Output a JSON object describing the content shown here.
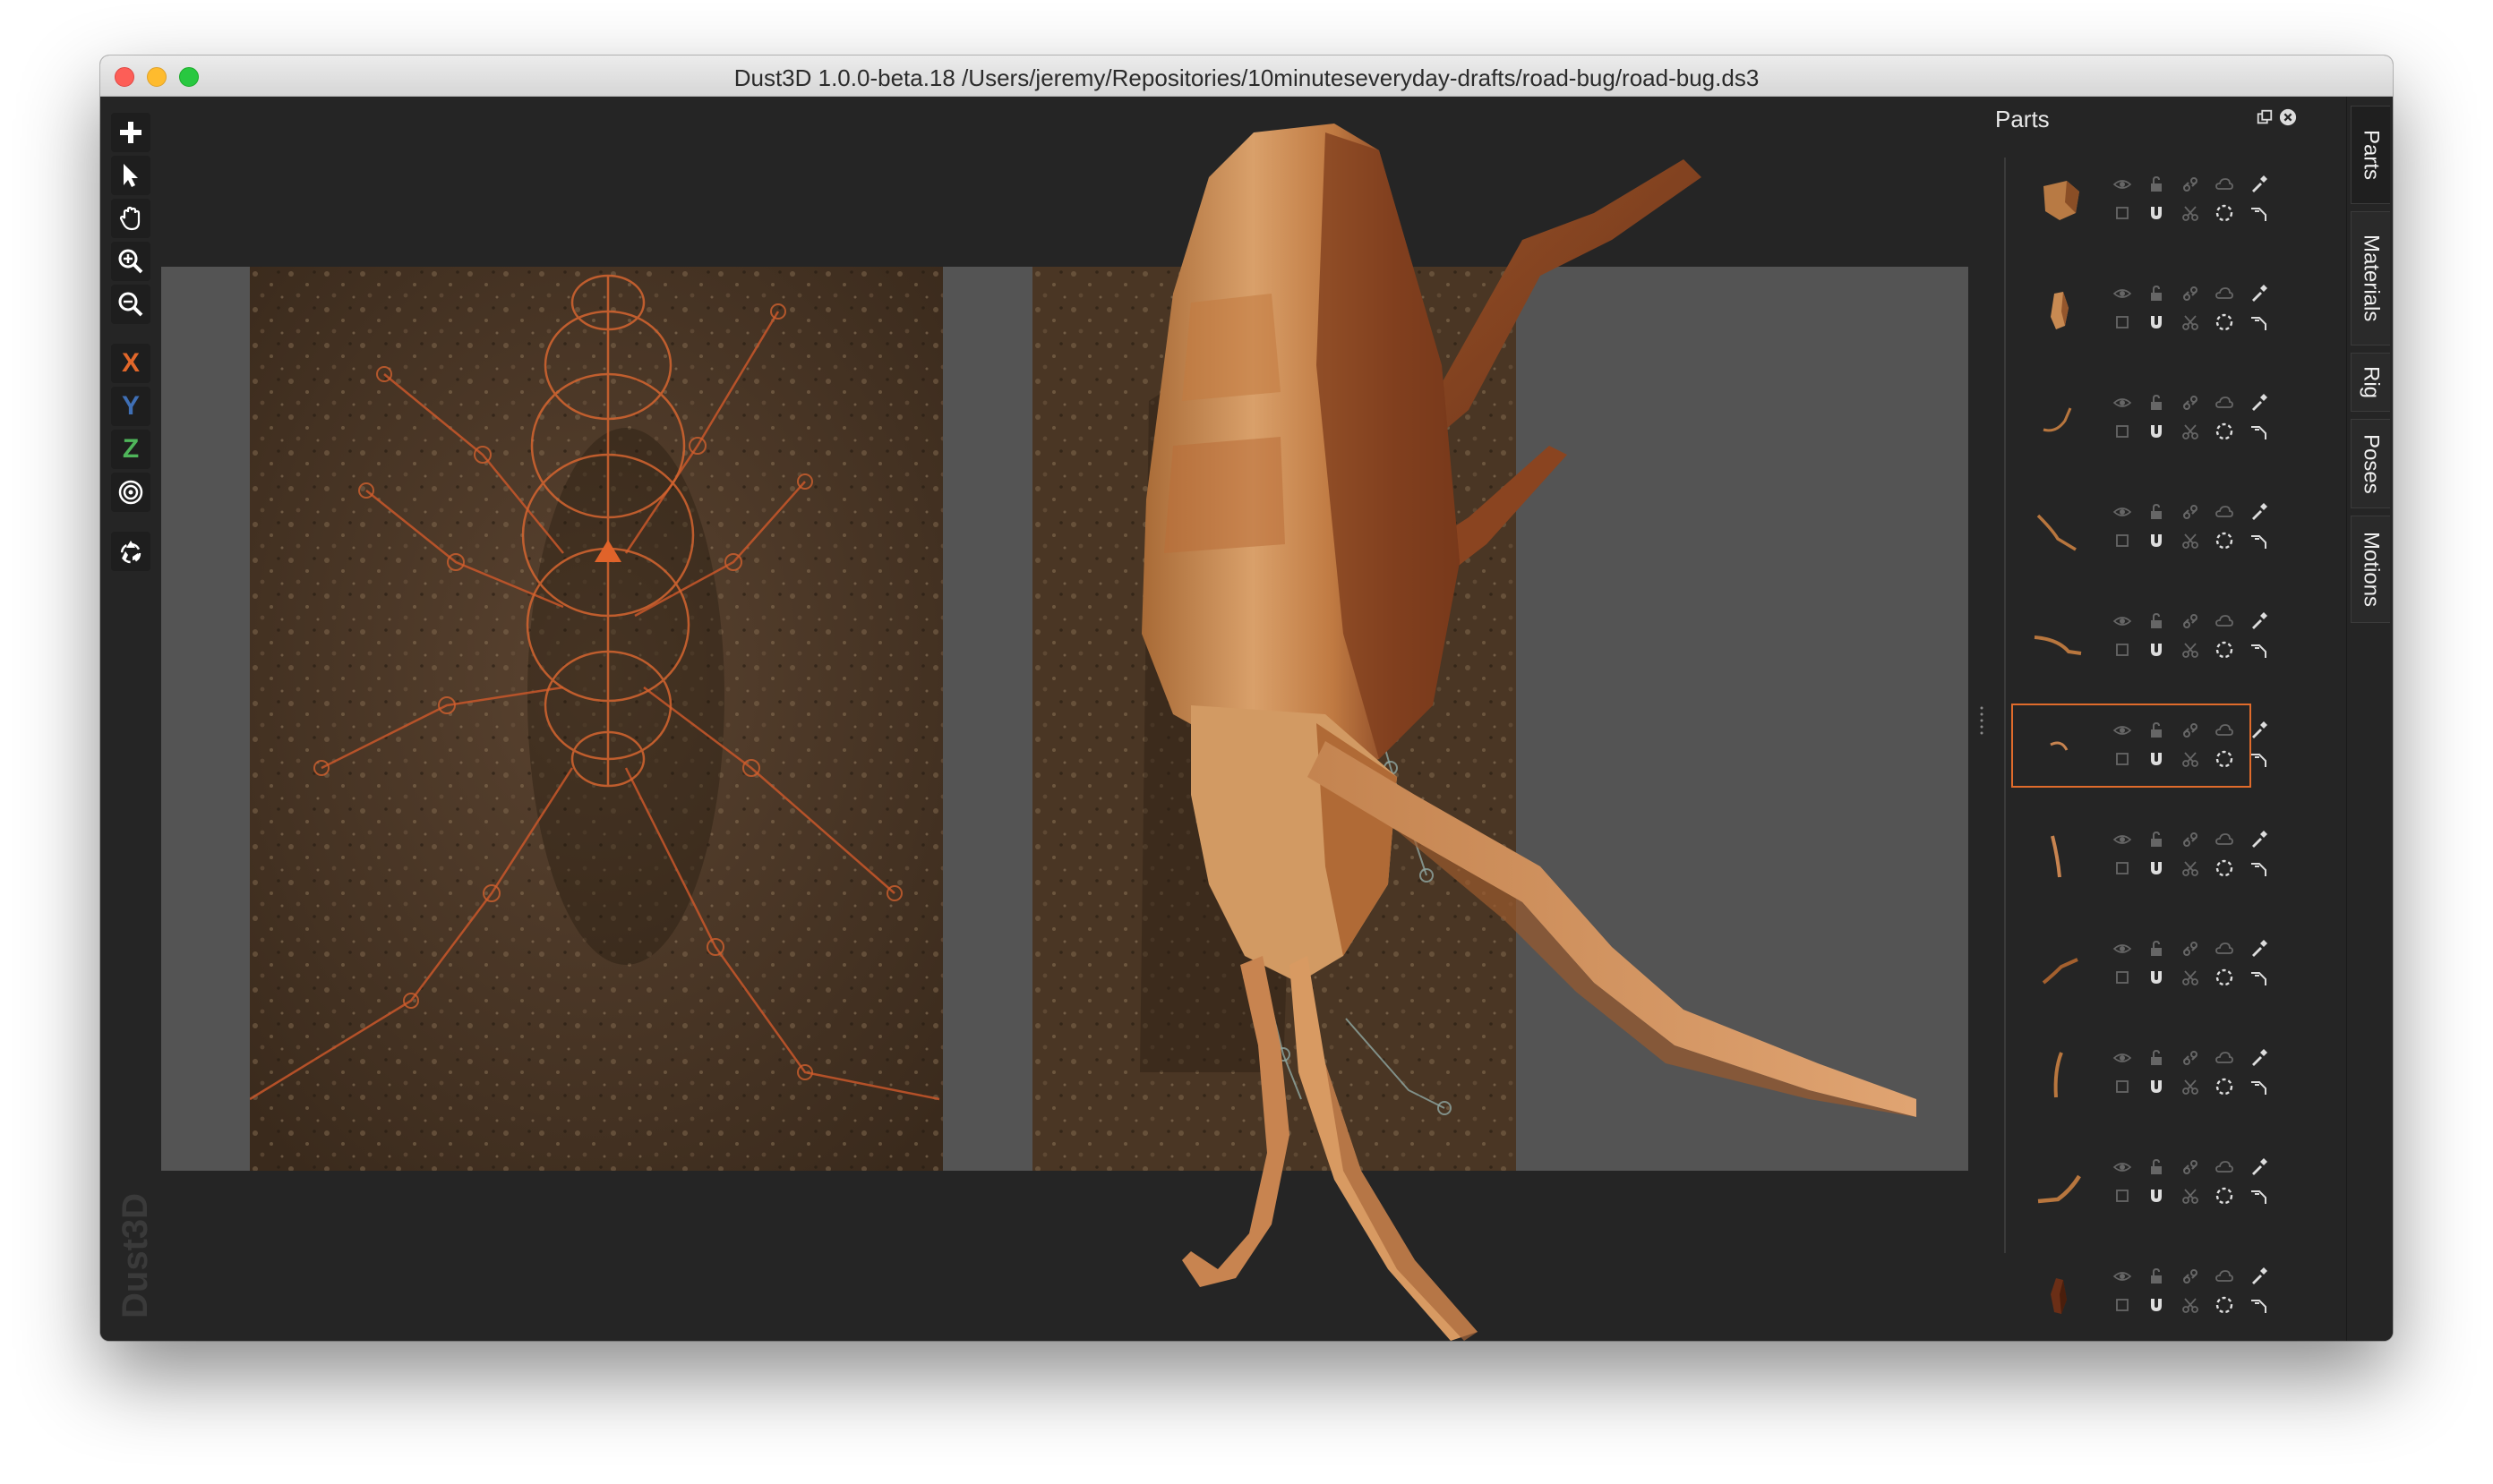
{
  "window": {
    "title": "Dust3D 1.0.0-beta.18 /Users/jeremy/Repositories/10minuteseveryday-drafts/road-bug/road-bug.ds3"
  },
  "toolbar": {
    "tools": [
      {
        "name": "add-icon"
      },
      {
        "name": "select-icon"
      },
      {
        "name": "drag-hand-icon"
      },
      {
        "name": "zoom-in-icon"
      },
      {
        "name": "zoom-out-icon"
      }
    ],
    "axes": [
      {
        "label": "X",
        "color": "#e2672a"
      },
      {
        "label": "Y",
        "color": "#3f6fb5"
      },
      {
        "label": "Z",
        "color": "#4fb55a"
      }
    ],
    "radial_icon": "radial-icon",
    "regenerate_icon": "recycle-icon"
  },
  "watermark": {
    "text": "Dust3D"
  },
  "parts_panel": {
    "title": "Parts",
    "selected_index": 5,
    "part_count": 11
  },
  "side_tabs": [
    "Parts",
    "Materials",
    "Rig",
    "Poses",
    "Motions"
  ],
  "colors": {
    "accent": "#e06b2b",
    "background": "#252525",
    "canvas": "#545454",
    "model_base": "#c88a4e",
    "model_dark": "#7a3e1e"
  }
}
